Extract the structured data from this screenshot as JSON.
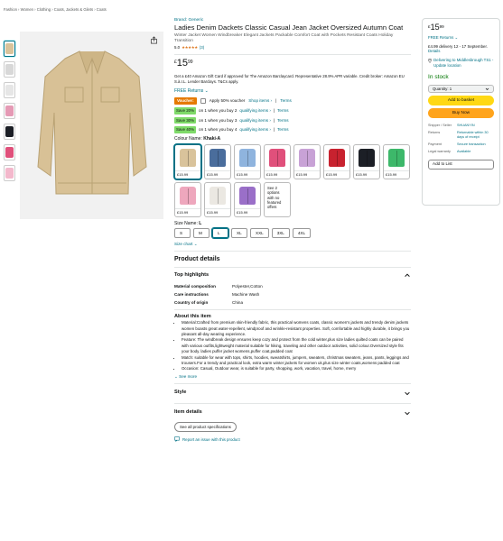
{
  "breadcrumb": "Fashion › Women › Clothing › Coats, Jackets & Gilets › Coats",
  "product": {
    "brand": "Brand: Generic",
    "title": "Ladies Denim Dackets Classic Casual Jean Jacket Oversized Autumn Coat",
    "subtitle": "Winter Jacket Women Windbreaker Elegant Jackets Packable Comfort Coat with Pockets Resistant Coats Holiday Transition",
    "rating_value": "5.0",
    "stars": "★★★★★",
    "rating_count": "(3)",
    "price": {
      "currency": "£",
      "whole": "15",
      "fraction": "99"
    },
    "promo": "Get a £40 Amazon Gift Card if approved for The Amazon Barclaycard. Representative 28.9% APR variable. Credit broker: Amazon EU S.à.r.L. Lender Barclays. T&Cs apply.",
    "free_returns": "FREE Returns ⌄",
    "voucher": {
      "badge": "Voucher:",
      "text": "Apply 50% voucher",
      "shop_items": "Shop items ›",
      "terms": "Terms"
    },
    "savings": [
      {
        "badge": "Save 20%",
        "text": "on 1 when you buy 2",
        "link": "qualifying items ›",
        "terms": "Terms"
      },
      {
        "badge": "Save 30%",
        "text": "on 1 when you buy 3",
        "link": "qualifying items ›",
        "terms": "Terms"
      },
      {
        "badge": "Save 40%",
        "text": "on 1 when you buy 4",
        "link": "qualifying items ›",
        "terms": "Terms"
      }
    ],
    "colour_label": "Colour Name:",
    "colour_value": "Khaki-A",
    "swatch_price": "£15.99",
    "swatches": [
      {
        "name": "khaki",
        "color": "#d9c39b"
      },
      {
        "name": "denim-blue",
        "color": "#4a6d9c"
      },
      {
        "name": "light-blue",
        "color": "#8fb4de"
      },
      {
        "name": "pink",
        "color": "#e0507b"
      },
      {
        "name": "lilac",
        "color": "#c8a2d6"
      },
      {
        "name": "red",
        "color": "#c8222f"
      },
      {
        "name": "black",
        "color": "#1c1f26"
      },
      {
        "name": "green",
        "color": "#3db86a"
      },
      {
        "name": "light-pink",
        "color": "#eea7bd"
      },
      {
        "name": "white",
        "color": "#ebe8e2"
      },
      {
        "name": "purple",
        "color": "#9a6fc8"
      }
    ],
    "more_options": "See 2 options with no featured offers",
    "size_label": "Size Name:",
    "size_value": "L",
    "sizes": [
      "S",
      "M",
      "L",
      "XL",
      "XXL",
      "3XL",
      "4XL"
    ],
    "size_chart": "Size chart ⌄"
  },
  "details": {
    "heading": "Product details",
    "top_highlights": "Top highlights",
    "specs": [
      {
        "k": "Material composition",
        "v": "Polyester,Cotton"
      },
      {
        "k": "Care instructions",
        "v": "Machine Wash"
      },
      {
        "k": "Country of origin",
        "v": "China"
      }
    ],
    "about_heading": "About this item",
    "about": [
      "Material:Crafted from premium skin-friendly fabric, this practical womens coats, classic women's jackets and trendy denim jackets women boasts great water-repellent, windproof and wrinkle-resistant properties. Soft, comfortable and highly durable, it brings you pleasant all-day wearing experience.",
      "Feature: The windbreak design ensures keep cozy and protect from the cold winter,plus size ladies quilted coats can be paired with various outfits,lightweight material suitable for hiking, traveling and other outdoor activities, solid colour.Oversized style fits your body. ladies puffer jacket womens,puffer coat,padded coat",
      "Match: suitable for wear with tops, shirts, hoodies, sweatshirts, jumpers, sweaters, christmas sweaters, jeans, pants, leggings and trousers.For a trendy and practical look, extra warm winter jackets for women uk,plus size winter coats,womens padded coat",
      "Occasion: Casual, Outdoor wear, is suitable for party, shopping, work, vacation, travel, home, merry"
    ],
    "see_more": "⌄ See more",
    "style": "Style",
    "item_details": "Item details",
    "see_all_specs": "See all product specifications",
    "report": "Report an issue with this product"
  },
  "buybox": {
    "price": {
      "currency": "£",
      "whole": "15",
      "fraction": "99"
    },
    "free_returns": "FREE Returns ⌄",
    "delivery": "£4.99 delivery 12 - 17 September.",
    "details_link": "Details",
    "deliver_to": "Delivering to Middlesbrough TS1 - Update location",
    "in_stock": "In stock",
    "quantity": "Quantity: 1",
    "add_to_basket": "Add to basket",
    "buy_now": "Buy Now",
    "meta": [
      {
        "k": "Shipper / Seller",
        "v": "SHUANYIN"
      },
      {
        "k": "Returns",
        "v": "Returnable within 30 days of receipt"
      },
      {
        "k": "Payment",
        "v": "Secure transaction"
      },
      {
        "k": "Legal warranty",
        "v": "Available"
      }
    ],
    "add_to_list": "Add to List"
  },
  "thumbnails": [
    {
      "color": "#d9c39b"
    },
    {
      "color": "#d8d8d8"
    },
    {
      "color": "#e6e6e6"
    },
    {
      "color": "#e59ab5"
    },
    {
      "color": "#1c1f26"
    },
    {
      "color": "#e0507b"
    },
    {
      "color": "#f3b8cc"
    }
  ],
  "colors": {
    "link": "#007185",
    "add": "#ffd814",
    "buy": "#ffa41c",
    "stock": "#007600"
  }
}
